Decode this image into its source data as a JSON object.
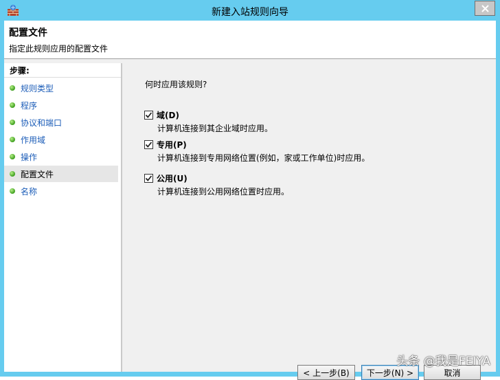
{
  "window": {
    "title": "新建入站规则向导",
    "close_glyph": "✕"
  },
  "header": {
    "title": "配置文件",
    "subtitle": "指定此规则应用的配置文件"
  },
  "sidebar": {
    "steps_title": "步骤:",
    "items": [
      {
        "label": "规则类型"
      },
      {
        "label": "程序"
      },
      {
        "label": "协议和端口"
      },
      {
        "label": "作用域"
      },
      {
        "label": "操作"
      },
      {
        "label": "配置文件",
        "active": true
      },
      {
        "label": "名称"
      }
    ]
  },
  "main": {
    "question": "何时应用该规则?",
    "options": [
      {
        "label": "域(D)",
        "description": "计算机连接到其企业域时应用。",
        "checked": true
      },
      {
        "label": "专用(P)",
        "description": "计算机连接到专用网络位置(例如，家或工作单位)时应用。",
        "checked": true
      },
      {
        "label": "公用(U)",
        "description": "计算机连接到公用网络位置时应用。",
        "checked": true
      }
    ]
  },
  "buttons": {
    "back": "< 上一步(B)",
    "next": "下一步(N) >",
    "cancel": "取消"
  },
  "watermark": "头条 @我是FEIYA",
  "colors": {
    "frame": "#66ccef",
    "step_link": "#1c5db8",
    "step_dot": "#3b9d1c"
  }
}
